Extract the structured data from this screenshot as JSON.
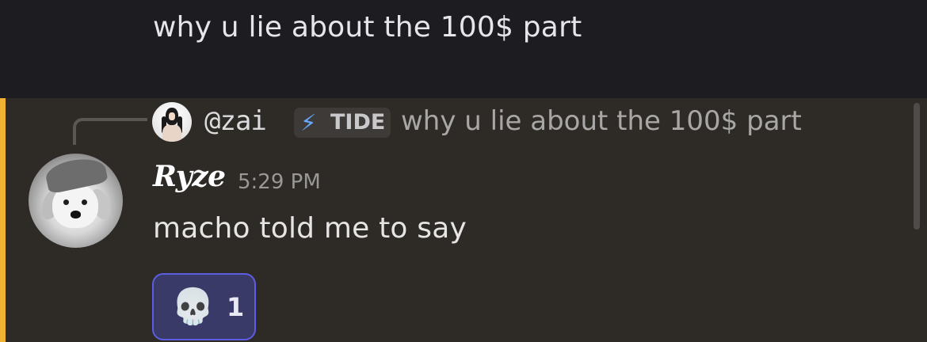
{
  "previous_message": {
    "text": "why u lie about the 100$ part"
  },
  "message": {
    "reply": {
      "username": "@zai",
      "guild_tag": "TIDE",
      "guild_tag_icon": "lightning-bolt-icon",
      "preview": "why u lie about the 100$ part"
    },
    "author": {
      "name": "Ryze",
      "timestamp": "5:29 PM"
    },
    "content": "macho told me to say",
    "reactions": [
      {
        "emoji": "💀",
        "emoji_name": "skull-emoji",
        "count": "1"
      }
    ]
  },
  "colors": {
    "mention_highlight_bar": "#f0b232",
    "reaction_border": "#5b5ee0",
    "guild_tag_bolt": "#68a8ff"
  }
}
